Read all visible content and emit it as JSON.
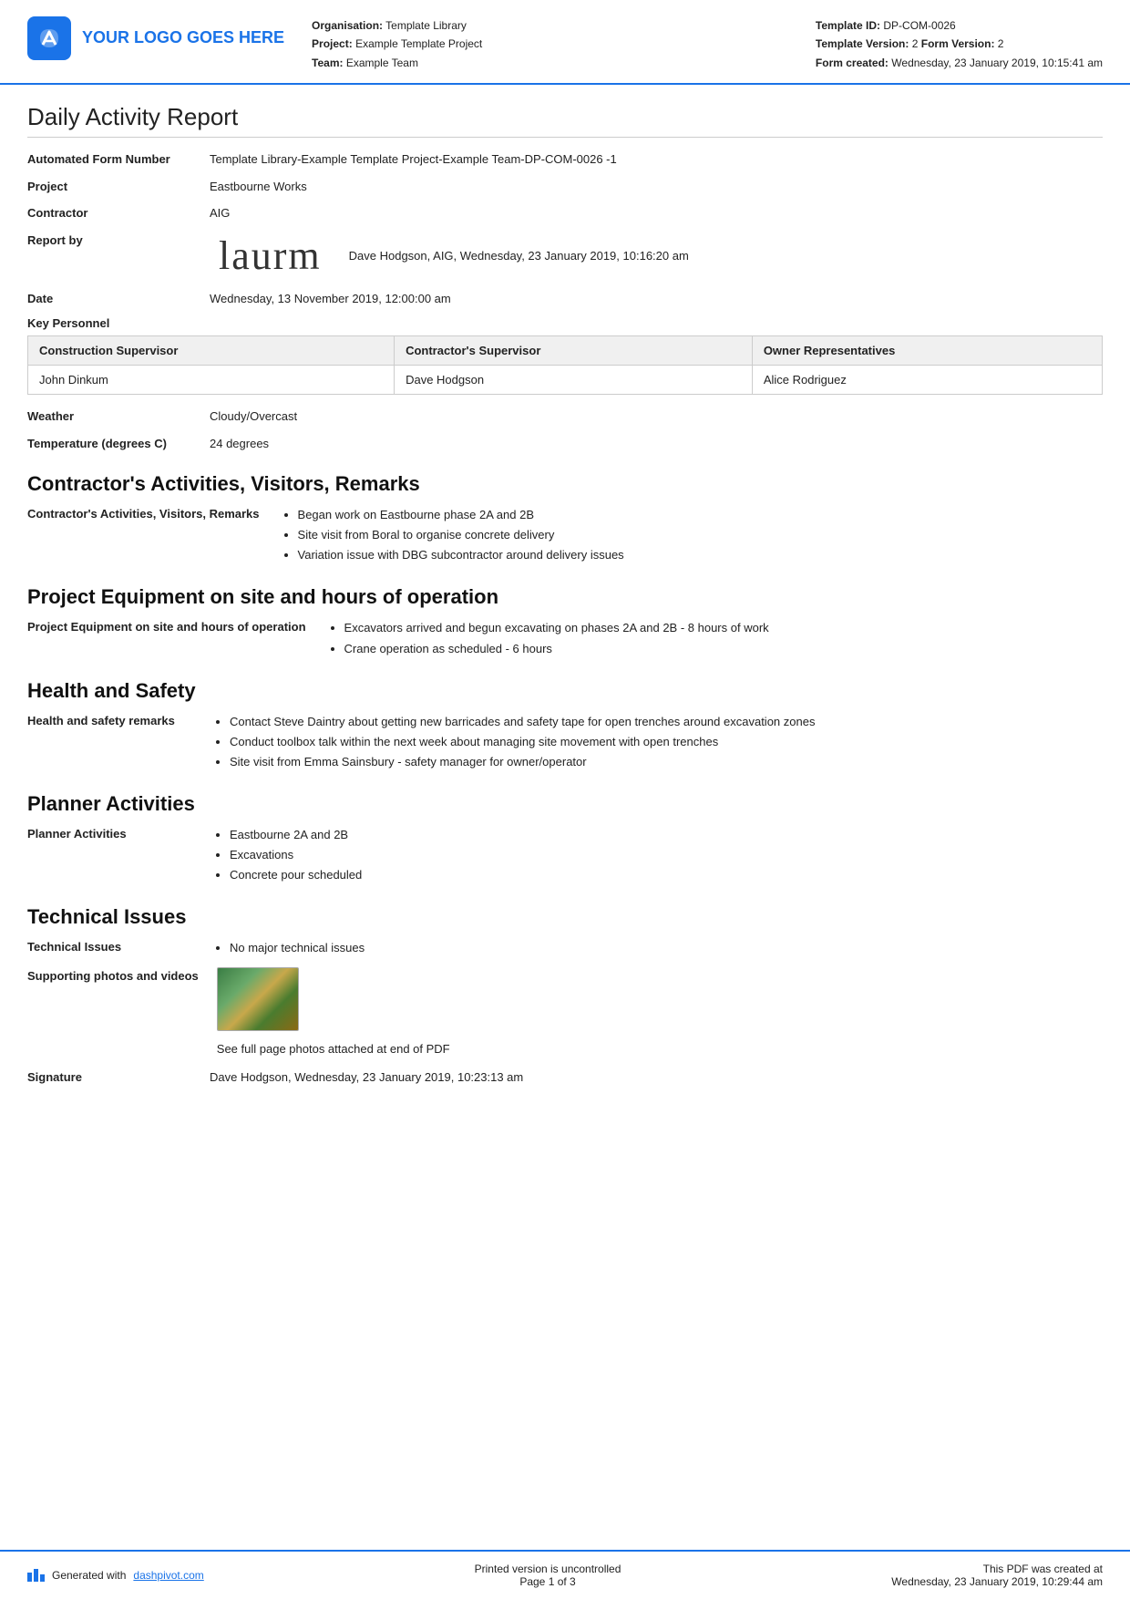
{
  "header": {
    "logo_text": "YOUR LOGO GOES HERE",
    "org_label": "Organisation:",
    "org_value": "Template Library",
    "project_label": "Project:",
    "project_value": "Example Template Project",
    "team_label": "Team:",
    "team_value": "Example Team",
    "template_id_label": "Template ID:",
    "template_id_value": "DP-COM-0026",
    "template_version_label": "Template Version:",
    "template_version_value": "2",
    "form_version_label": "Form Version:",
    "form_version_value": "2",
    "form_created_label": "Form created:",
    "form_created_value": "Wednesday, 23 January 2019, 10:15:41 am"
  },
  "report": {
    "title": "Daily Activity Report",
    "form_number_label": "Automated Form Number",
    "form_number_value": "Template Library-Example Template Project-Example Team-DP-COM-0026   -1",
    "project_label": "Project",
    "project_value": "Eastbourne Works",
    "contractor_label": "Contractor",
    "contractor_value": "AIG",
    "report_by_label": "Report by",
    "report_by_text": "Dave Hodgson, AIG, Wednesday, 23 January 2019, 10:16:20 am",
    "date_label": "Date",
    "date_value": "Wednesday, 13 November 2019, 12:00:00 am"
  },
  "key_personnel": {
    "label": "Key Personnel",
    "col1": "Construction Supervisor",
    "col2": "Contractor's Supervisor",
    "col3": "Owner Representatives",
    "row1_col1": "John Dinkum",
    "row1_col2": "Dave Hodgson",
    "row1_col3": "Alice Rodriguez"
  },
  "weather": {
    "label": "Weather",
    "value": "Cloudy/Overcast",
    "temp_label": "Temperature (degrees C)",
    "temp_value": "24 degrees"
  },
  "contractors_activities": {
    "section_title": "Contractor's Activities, Visitors, Remarks",
    "field_label": "Contractor's Activities, Visitors, Remarks",
    "items": [
      "Began work on Eastbourne phase 2A and 2B",
      "Site visit from Boral to organise concrete delivery",
      "Variation issue with DBG subcontractor around delivery issues"
    ]
  },
  "project_equipment": {
    "section_title": "Project Equipment on site and hours of operation",
    "field_label": "Project Equipment on site and hours of operation",
    "items": [
      "Excavators arrived and begun excavating on phases 2A and 2B - 8 hours of work",
      "Crane operation as scheduled - 6 hours"
    ]
  },
  "health_safety": {
    "section_title": "Health and Safety",
    "field_label": "Health and safety remarks",
    "items": [
      "Contact Steve Daintry about getting new barricades and safety tape for open trenches around excavation zones",
      "Conduct toolbox talk within the next week about managing site movement with open trenches",
      "Site visit from Emma Sainsbury - safety manager for owner/operator"
    ]
  },
  "planner_activities": {
    "section_title": "Planner Activities",
    "field_label": "Planner Activities",
    "items": [
      "Eastbourne 2A and 2B",
      "Excavations",
      "Concrete pour scheduled"
    ]
  },
  "technical_issues": {
    "section_title": "Technical Issues",
    "field_label": "Technical Issues",
    "items": [
      "No major technical issues"
    ],
    "photos_label": "Supporting photos and videos",
    "photos_caption": "See full page photos attached at end of PDF",
    "signature_label": "Signature",
    "signature_value": "Dave Hodgson, Wednesday, 23 January 2019, 10:23:13 am"
  },
  "footer": {
    "generated_text": "Generated with",
    "link_text": "dashpivot.com",
    "center_line1": "Printed version is uncontrolled",
    "center_line2": "Page 1 of 3",
    "right_line1": "This PDF was created at",
    "right_line2": "Wednesday, 23 January 2019, 10:29:44 am"
  }
}
